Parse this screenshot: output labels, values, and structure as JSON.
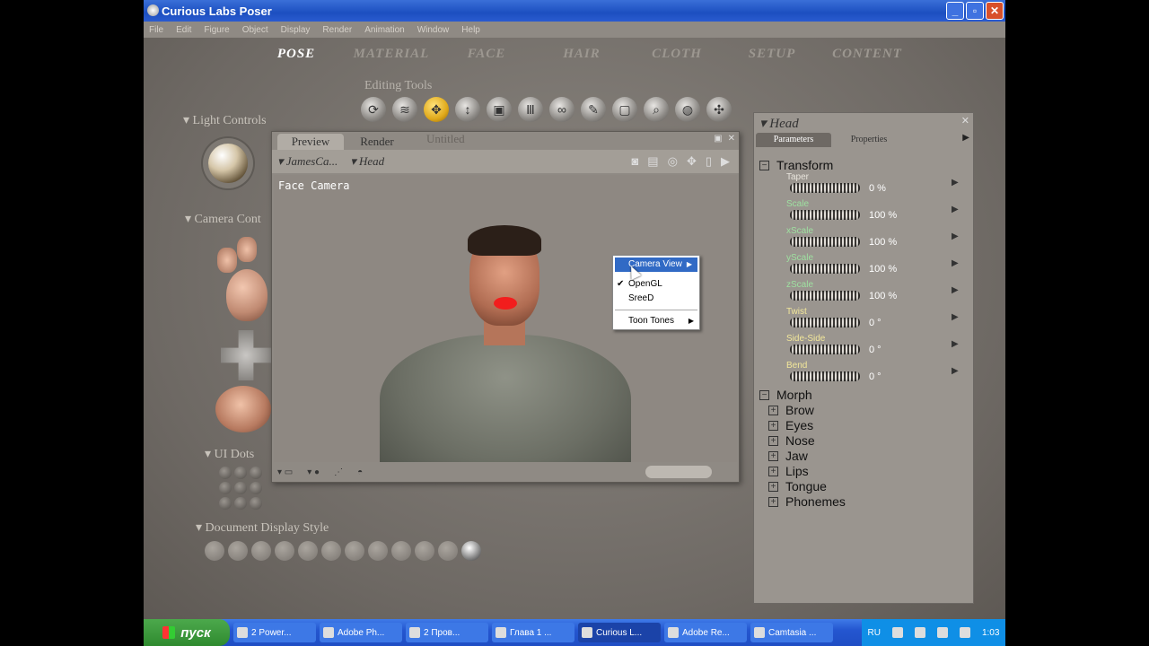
{
  "window": {
    "title": "Curious Labs Poser",
    "min": "_",
    "max": "▫",
    "close": "✕"
  },
  "menu": [
    "File",
    "Edit",
    "Figure",
    "Object",
    "Display",
    "Render",
    "Animation",
    "Window",
    "Help"
  ],
  "rooms": [
    "POSE",
    "MATERIAL",
    "FACE",
    "HAIR",
    "CLOTH",
    "SETUP",
    "CONTENT"
  ],
  "editing_tools_label": "Editing Tools",
  "tools": [
    "rotate-icon",
    "twist-icon",
    "translate-icon",
    "translate-in-out-icon",
    "scale-icon",
    "taper-icon",
    "chain-break-icon",
    "color-icon",
    "grouping-icon",
    "view-magnifier-icon",
    "morphing-tool-icon",
    "direct-manipulation-icon"
  ],
  "left": {
    "light_controls": "Light Controls",
    "camera_controls": "Camera Cont",
    "ui_dots": "UI Dots",
    "doc_display_style": "Document Display Style"
  },
  "document": {
    "tabs": [
      "Preview",
      "Render"
    ],
    "title": "Untitled",
    "camera_select": "JamesCa...",
    "element_select": "Head",
    "viewport_label": "Face Camera"
  },
  "context_menu": {
    "items": [
      {
        "label": "Camera View",
        "submenu": true,
        "highlighted": true
      },
      {
        "label": "OpenGL",
        "checked": true
      },
      {
        "label": "SreeD"
      },
      {
        "label": "Toon Tones",
        "submenu": true
      }
    ]
  },
  "params": {
    "title": "Head",
    "tabs": [
      "Parameters",
      "Properties"
    ],
    "transform_label": "Transform",
    "dials": [
      {
        "name": "Taper",
        "value": "0 %",
        "color": "#e8e4dc"
      },
      {
        "name": "Scale",
        "value": "100 %",
        "color": "#9ee0a0"
      },
      {
        "name": "xScale",
        "value": "100 %",
        "color": "#9ee0a0"
      },
      {
        "name": "yScale",
        "value": "100 %",
        "color": "#9ee0a0"
      },
      {
        "name": "zScale",
        "value": "100 %",
        "color": "#9ee0a0"
      },
      {
        "name": "Twist",
        "value": "0 °",
        "color": "#f2e79a"
      },
      {
        "name": "Side-Side",
        "value": "0 °",
        "color": "#f2e79a"
      },
      {
        "name": "Bend",
        "value": "0 °",
        "color": "#f2e79a"
      }
    ],
    "morph_label": "Morph",
    "morphs": [
      "Brow",
      "Eyes",
      "Nose",
      "Jaw",
      "Lips",
      "Tongue",
      "Phonemes"
    ]
  },
  "taskbar": {
    "start": "пуск",
    "tasks": [
      "2 Power...",
      "Adobe Ph...",
      "2 Пров...",
      "Глава 1 ...",
      "Curious L...",
      "Adobe Re...",
      "Camtasia ..."
    ],
    "lang": "RU",
    "clock": "1:03"
  }
}
